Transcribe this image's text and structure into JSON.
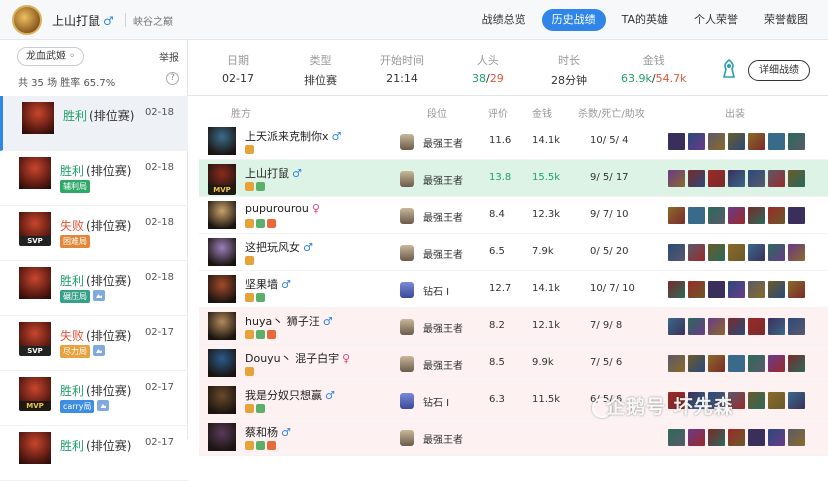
{
  "header": {
    "player_name": "上山打鼠",
    "gender_symbol": "♂",
    "server": "峡谷之巅",
    "tabs": [
      {
        "label": "战绩总览",
        "active": false
      },
      {
        "label": "历史战绩",
        "active": true
      },
      {
        "label": "TA的英雄",
        "active": false
      },
      {
        "label": "个人荣誉",
        "active": false
      },
      {
        "label": "荣誉截图",
        "active": false
      }
    ]
  },
  "sidebar": {
    "filter_label": "龙血武姬 ◦",
    "report_label": "举报",
    "stats_text": "共 35 场   胜率 65.7%",
    "help_symbol": "?",
    "matches": [
      {
        "result": "胜利",
        "mode": "(排位赛)",
        "date": "02-18",
        "badge": "",
        "tags": [],
        "selected": true
      },
      {
        "result": "胜利",
        "mode": "(排位赛)",
        "date": "02-18",
        "badge": "",
        "tags": [
          {
            "text": "辅利局",
            "color": "#2ea866"
          }
        ]
      },
      {
        "result": "失败",
        "mode": "(排位赛)",
        "date": "02-18",
        "badge": "SVP",
        "tags": [
          {
            "text": "困难局",
            "color": "#e2883a"
          }
        ]
      },
      {
        "result": "胜利",
        "mode": "(排位赛)",
        "date": "02-18",
        "badge": "",
        "tags": [
          {
            "text": "碾压局",
            "color": "#36a089"
          },
          {
            "text": "pic",
            "color": ""
          }
        ]
      },
      {
        "result": "失败",
        "mode": "(排位赛)",
        "date": "02-17",
        "badge": "SVP",
        "tags": [
          {
            "text": "尽力局",
            "color": "#e9a240"
          },
          {
            "text": "pic",
            "color": ""
          }
        ]
      },
      {
        "result": "胜利",
        "mode": "(排位赛)",
        "date": "02-17",
        "badge": "MVP",
        "tags": [
          {
            "text": "carry局",
            "color": "#3d8de0"
          },
          {
            "text": "pic",
            "color": ""
          }
        ]
      },
      {
        "result": "胜利",
        "mode": "(排位赛)",
        "date": "02-17",
        "badge": "",
        "tags": []
      }
    ]
  },
  "summary": {
    "date_label": "日期",
    "date": "02-17",
    "type_label": "类型",
    "type": "排位赛",
    "start_label": "开始时间",
    "start": "21:14",
    "kills_label": "人头",
    "kills_a": "38",
    "kills_sep": "/",
    "kills_b": "29",
    "duration_label": "时长",
    "duration": "28分钟",
    "gold_label": "金钱",
    "gold_a": "63.9k",
    "gold_sep": "/",
    "gold_b": "54.7k",
    "detail_button": "详细战绩"
  },
  "table": {
    "headers": {
      "side": "胜方",
      "rank": "段位",
      "rating": "评价",
      "money": "金钱",
      "kda": "杀数/死亡/助攻",
      "items": "出装"
    },
    "rows": [
      {
        "name": "上天派来克制你x",
        "gender": "♂",
        "rank": "最强王者",
        "rating": "11.6",
        "money": "14.1k",
        "kda": "10/ 5/ 4",
        "me": false,
        "lose": false,
        "mvp": false,
        "champ_color": "#3b6c8c"
      },
      {
        "name": "上山打鼠",
        "gender": "♂",
        "rank": "最强王者",
        "rating": "13.8",
        "money": "15.5k",
        "kda": "9/ 5/ 17",
        "me": true,
        "lose": false,
        "mvp": true,
        "champ_color": "#8c2a1c"
      },
      {
        "name": "pupurourou",
        "gender": "♀",
        "rank": "最强王者",
        "rating": "8.4",
        "money": "12.3k",
        "kda": "9/ 7/ 10",
        "me": false,
        "lose": false,
        "mvp": false,
        "champ_color": "#c9a36a"
      },
      {
        "name": "这把玩风女",
        "gender": "♂",
        "rank": "最强王者",
        "rating": "6.5",
        "money": "7.9k",
        "kda": "0/ 5/ 20",
        "me": false,
        "lose": false,
        "mvp": false,
        "champ_color": "#9a7fb8"
      },
      {
        "name": "坚果墙",
        "gender": "♂",
        "rank": "钻石 I",
        "rating": "12.7",
        "money": "14.1k",
        "kda": "10/ 7/ 10",
        "me": false,
        "lose": false,
        "mvp": false,
        "champ_color": "#a44a2a"
      },
      {
        "name": "huya丶 狮子汪",
        "gender": "♂",
        "rank": "最强王者",
        "rating": "8.2",
        "money": "12.1k",
        "kda": "7/ 9/ 8",
        "me": false,
        "lose": true,
        "mvp": false,
        "champ_color": "#b38a5a"
      },
      {
        "name": "Douyu丶 混子白宇",
        "gender": "♀",
        "rank": "最强王者",
        "rating": "8.5",
        "money": "9.9k",
        "kda": "7/ 5/ 6",
        "me": false,
        "lose": true,
        "mvp": false,
        "champ_color": "#2a5a8a"
      },
      {
        "name": "我是分奴只想赢",
        "gender": "♂",
        "rank": "钻石 I",
        "rating": "6.3",
        "money": "11.5k",
        "kda": "6/ 5/ 6",
        "me": false,
        "lose": true,
        "mvp": false,
        "champ_color": "#6a4a2a"
      },
      {
        "name": "蔡和杨",
        "gender": "♂",
        "rank": "最强王者",
        "rating": "",
        "money": "",
        "kda": "",
        "me": false,
        "lose": true,
        "mvp": false,
        "champ_color": "#5a3a5a"
      }
    ]
  },
  "watermark": "企鹅号 坏先森"
}
